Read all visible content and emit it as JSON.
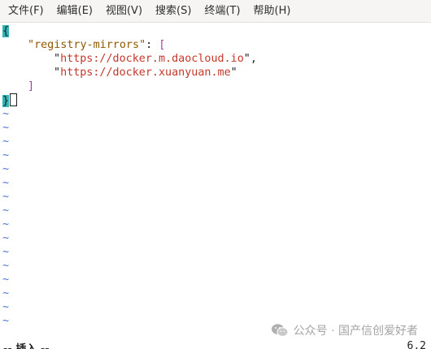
{
  "menu": {
    "items": [
      "文件(F)",
      "编辑(E)",
      "视图(V)",
      "搜索(S)",
      "终端(T)",
      "帮助(H)"
    ]
  },
  "editor": {
    "open_brace": "{",
    "key_quote_open": "\"",
    "key": "registry-mirrors",
    "key_quote_close": "\"",
    "colon": ": ",
    "array_open": "[",
    "url1_quote_open": "\"",
    "url1": "https://docker.m.daocloud.io",
    "url1_quote_close": "\"",
    "comma": ",",
    "url2_quote_open": "\"",
    "url2": "https://docker.xuanyuan.me",
    "url2_quote_close": "\"",
    "array_close": "]",
    "close_brace": "}",
    "empty_line_marker": "~"
  },
  "status": {
    "mode": "-- 插入 --",
    "cursor_position": "6,2"
  },
  "watermark": {
    "text": "公众号 · 国产信创爱好者",
    "icon": "wechat-icon"
  },
  "colors": {
    "bracket_highlight": "#2fb5b5",
    "string": "#c4372b",
    "key": "#8f5902",
    "bracket": "#a23f9f",
    "tilde": "#4a74c8"
  }
}
